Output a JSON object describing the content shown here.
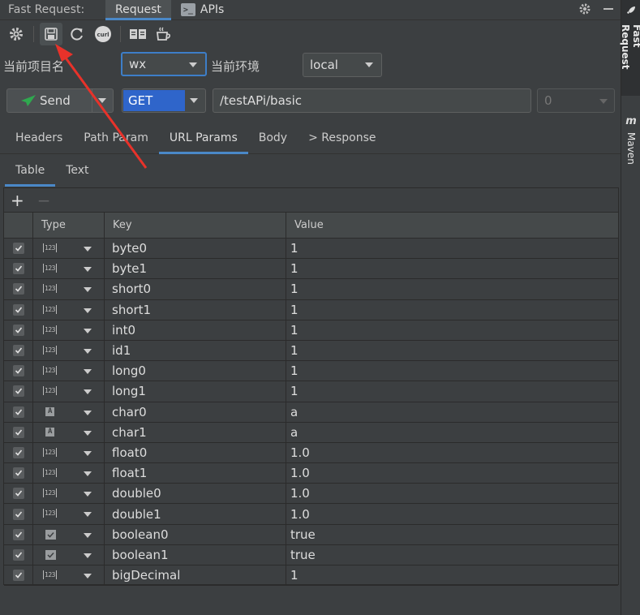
{
  "titlebar": {
    "app_title": "Fast Request:",
    "tabs": [
      "Request",
      "APIs"
    ],
    "apis_icon_text": ">_"
  },
  "stripe": {
    "fast_request_label": "Fast Request",
    "maven_icon": "m",
    "maven_label": "Maven"
  },
  "toolbar": {
    "icons": [
      "gear-icon",
      "save-icon",
      "refresh-icon",
      "curl-icon",
      "docs-icon",
      "coffee-icon"
    ],
    "curl_text": "curl"
  },
  "env": {
    "project_label": "当前项目名",
    "project_value": "wx",
    "env_label": "当前环境",
    "env_value": "local"
  },
  "request": {
    "send_label": "Send",
    "method": "GET",
    "url": "/testAPi/basic",
    "port": "0"
  },
  "tabs": [
    "Headers",
    "Path Param",
    "URL Params",
    "Body",
    "> Response"
  ],
  "subtabs": [
    "Table",
    "Text"
  ],
  "table": {
    "add": "+",
    "remove": "−",
    "columns": [
      "Type",
      "Key",
      "Value"
    ],
    "rows": [
      {
        "type": "123",
        "key": "byte0",
        "value": "1"
      },
      {
        "type": "123",
        "key": "byte1",
        "value": "1"
      },
      {
        "type": "123",
        "key": "short0",
        "value": "1"
      },
      {
        "type": "123",
        "key": "short1",
        "value": "1"
      },
      {
        "type": "123",
        "key": "int0",
        "value": "1"
      },
      {
        "type": "123",
        "key": "id1",
        "value": "1"
      },
      {
        "type": "123",
        "key": "long0",
        "value": "1"
      },
      {
        "type": "123",
        "key": "long1",
        "value": "1"
      },
      {
        "type": "A",
        "key": "char0",
        "value": "a"
      },
      {
        "type": "A",
        "key": "char1",
        "value": "a"
      },
      {
        "type": "123",
        "key": "float0",
        "value": "1.0"
      },
      {
        "type": "123",
        "key": "float1",
        "value": "1.0"
      },
      {
        "type": "123",
        "key": "double0",
        "value": "1.0"
      },
      {
        "type": "123",
        "key": "double1",
        "value": "1.0"
      },
      {
        "type": "bool",
        "key": "boolean0",
        "value": "true"
      },
      {
        "type": "bool",
        "key": "boolean1",
        "value": "true"
      },
      {
        "type": "123",
        "key": "bigDecimal",
        "value": "1"
      }
    ]
  },
  "colors": {
    "accent": "#4a88c7",
    "method_bg": "#2f65ca",
    "send_icon": "#2fa84f",
    "annotation": "#e8322a"
  }
}
